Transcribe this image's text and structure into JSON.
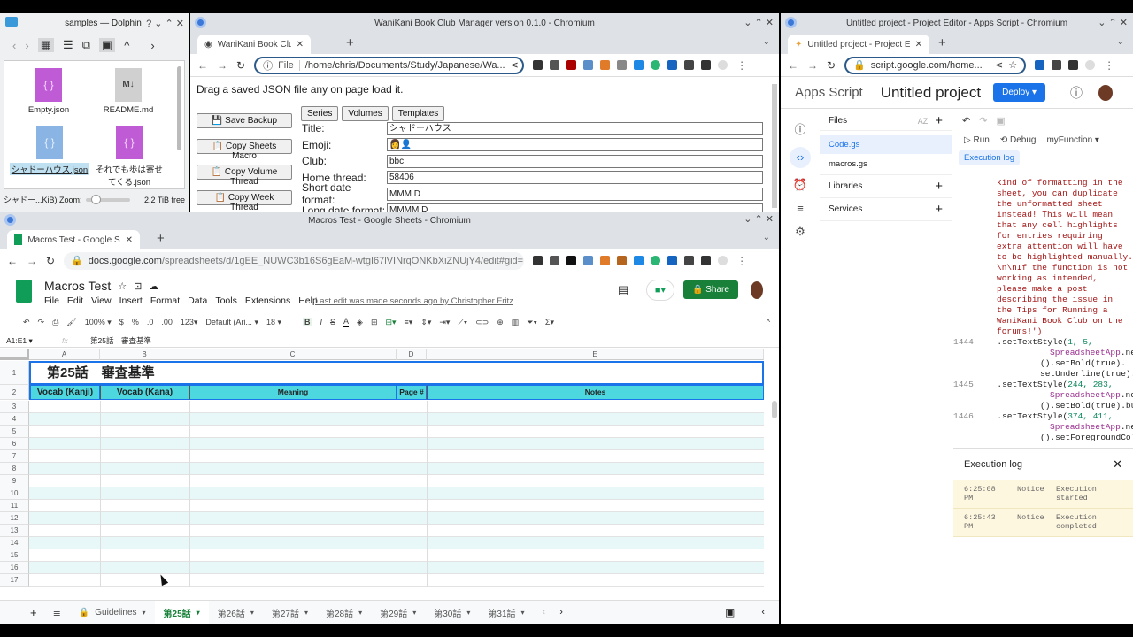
{
  "dolphin": {
    "title": "samples — Dolphin",
    "files": [
      {
        "name": "Empty.json",
        "type": "json"
      },
      {
        "name": "README.md",
        "type": "md"
      },
      {
        "name": "シャドーハウス.json",
        "type": "json",
        "selected": true
      },
      {
        "name": "それでも歩は寄せてくる.json",
        "type": "json"
      }
    ],
    "status": "シャドー...KiB) Zoom:",
    "free": "2.2 TiB free",
    "zoom_level": 0.2
  },
  "wk": {
    "window_title": "WaniKani Book Club Manager version 0.1.0 - Chromium",
    "tab": "WaniKani Book Club Manage",
    "url_label": "File",
    "url": "/home/chris/Documents/Study/Japanese/Wa...",
    "hint": "Drag a saved JSON file any on page load it.",
    "buttons": [
      "💾 Save Backup",
      "📋 Copy Sheets Macro",
      "📋 Copy Volume Thread",
      "📋 Copy Week Thread"
    ],
    "tabs": [
      "Series",
      "Volumes",
      "Templates"
    ],
    "fields": [
      {
        "label": "Title:",
        "value": "シャドーハウス"
      },
      {
        "label": "Emoji:",
        "value": "👩👤"
      },
      {
        "label": "Club:",
        "value": "bbc"
      },
      {
        "label": "Home thread:",
        "value": "58406"
      },
      {
        "label": "Short date format:",
        "value": "MMM D"
      },
      {
        "label": "Long date format:",
        "value": "MMMM D"
      }
    ]
  },
  "sheets": {
    "window_title": "Macros Test - Google Sheets - Chromium",
    "tab": "Macros Test - Google Sheets",
    "url_host": "docs.google.com",
    "url_path": "/spreadsheets/d/1gEE_NUWC3b16S6gEaM-wtgI67lVINrqONKbXiZNUjY4/edit#gid=...",
    "doc_title": "Macros Test",
    "menu": [
      "File",
      "Edit",
      "View",
      "Insert",
      "Format",
      "Data",
      "Tools",
      "Extensions",
      "Help"
    ],
    "last_edit": "Last edit was made seconds ago by Christopher Fritz",
    "share": "Share",
    "toolbar": {
      "zoom": "100%",
      "currency": "$",
      "percent": "%",
      "dec_less": ".0",
      "dec_more": ".00",
      "format": "123",
      "font": "Default (Ari...",
      "size": "18"
    },
    "cell_ref": "A1:E1",
    "formula": "第25話　審査基準",
    "columns": [
      "A",
      "B",
      "C",
      "D",
      "E"
    ],
    "title_cell": "第25話　審査基準",
    "headers": [
      "Vocab (Kanji)",
      "Vocab (Kana)",
      "Meaning",
      "Page #",
      "Notes"
    ],
    "rows": [
      "3",
      "4",
      "5",
      "6",
      "7",
      "8",
      "9",
      "10",
      "11",
      "12",
      "13",
      "14",
      "15",
      "16",
      "17"
    ],
    "sheet_tabs": [
      "Guidelines",
      "第25話",
      "第26話",
      "第27話",
      "第28話",
      "第29話",
      "第30話",
      "第31話"
    ],
    "active_tab": "第25話",
    "accent": "#4dd8e0"
  },
  "apps": {
    "window_title": "Untitled project - Project Editor - Apps Script - Chromium",
    "tab": "Untitled project - Project Edit",
    "url": "script.google.com/home...",
    "brand": "Apps Script",
    "project": "Untitled project",
    "deploy": "Deploy",
    "files_label": "Files",
    "files": [
      "Code.gs",
      "macros.gs"
    ],
    "libraries": "Libraries",
    "services": "Services",
    "run": "Run",
    "debug": "Debug",
    "function": "myFunction",
    "exec_log_btn": "Execution log",
    "code_string": "kind of formatting in the\nsheet, you can duplicate\nthe unformatted sheet\ninstead! This will mean\nthat any cell highlights\nfor entries requiring\nextra attention will have\nto be highlighted manually.\n\\n\\nIf the function is not\nworking as intended,\nplease make a post\ndescribing the issue in\nthe Tips for Running a\nWaniKani Book Club on the\nforums!')",
    "code_lines": [
      {
        "n": "1444",
        "a": "  .setTextStyle(",
        "nums": "1, 5,",
        "b": "SpreadsheetApp",
        ".c": "",
        "c": ".newTextStyle\n().setBold(true).\nsetUnderline(true).build())"
      },
      {
        "n": "1445",
        "a": "  .setTextStyle(",
        "nums": "244, 283,",
        "b": "SpreadsheetApp",
        "c": ".newTextStyle\n().setBold(true).build())"
      },
      {
        "n": "1446",
        "a": "  .setTextStyle(",
        "nums": "374, 411,",
        "b": "SpreadsheetApp",
        "c": ".newTextStyle\n().setForegroundColor"
      }
    ],
    "log_title": "Execution log",
    "log": [
      {
        "time": "6:25:08 PM",
        "level": "Notice",
        "msg": "Execution started"
      },
      {
        "time": "6:25:43 PM",
        "level": "Notice",
        "msg": "Execution completed"
      }
    ]
  }
}
